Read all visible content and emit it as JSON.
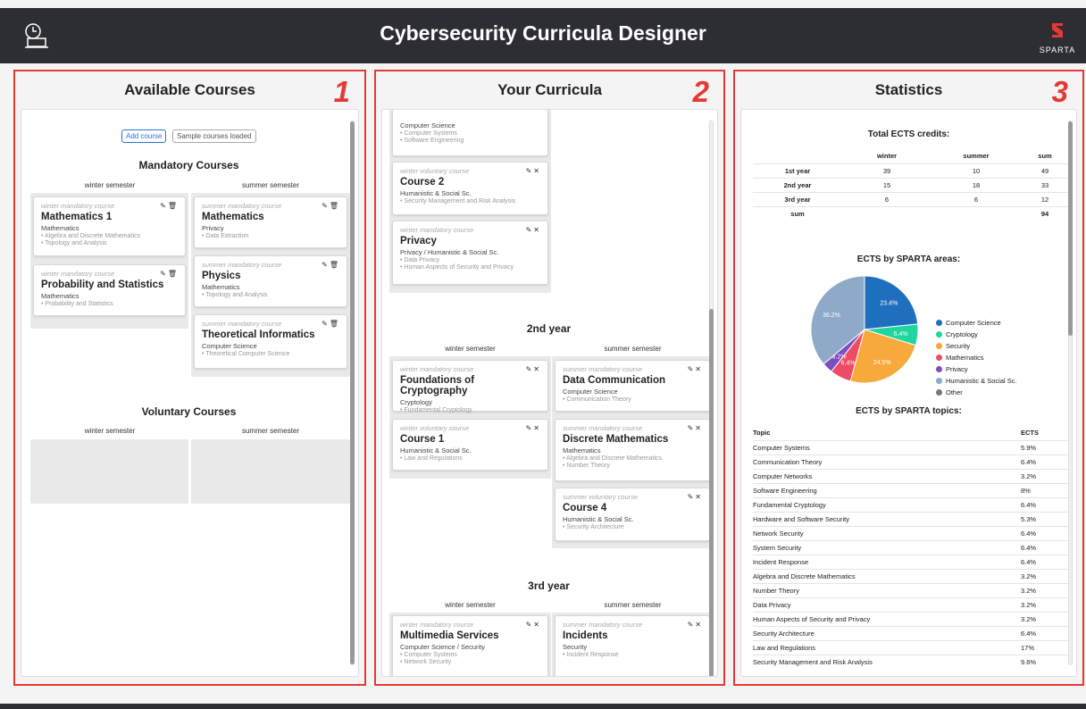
{
  "app": {
    "title": "Cybersecurity Curricula Designer",
    "logo_text": "SPARTA"
  },
  "colors": {
    "red": "#e53935",
    "dark": "#2d2e33"
  },
  "panels": {
    "available": "Available Courses",
    "curricula": "Your Curricula",
    "stats": "Statistics"
  },
  "numbers": [
    "1",
    "2",
    "3"
  ],
  "available": {
    "add_btn": "Add course",
    "sample_btn": "Sample courses loaded",
    "mandatory_title": "Mandatory Courses",
    "voluntary_title": "Voluntary Courses",
    "winter": "winter semester",
    "summer": "summer semester",
    "winter_cards": [
      {
        "type": "winter mandatory course",
        "name": "Mathematics 1",
        "area": "Mathematics",
        "topics": "• Algebra and Discrete Mathematics",
        "topics2": "• Topology and Analysis"
      },
      {
        "type": "winter mandatory course",
        "name": "Probability and Statistics",
        "area": "Mathematics",
        "topics": "• Probability and Statistics",
        "topics2": ""
      }
    ],
    "summer_cards": [
      {
        "type": "summer mandatory course",
        "name": "Mathematics",
        "area": "Privacy",
        "topics": "• Data Extraction",
        "topics2": ""
      },
      {
        "type": "summer mandatory course",
        "name": "Physics",
        "area": "Mathematics",
        "topics": "• Topology and Analysis",
        "topics2": ""
      },
      {
        "type": "summer mandatory course",
        "name": "Theoretical Informatics",
        "area": "Computer Science",
        "topics": "• Theoretical Computer Science",
        "topics2": ""
      }
    ]
  },
  "curricula": {
    "year2": "2nd year",
    "year3": "3rd year",
    "winter": "winter semester",
    "summer": "summer semester",
    "top_partial": {
      "area": "Computer Science",
      "t1": "• Computer Systems",
      "t2": "• Software Engineering"
    },
    "y1_cards": [
      {
        "type": "winter voluntary course",
        "name": "Course 2",
        "area": "Humanistic & Social Sc.",
        "topics": "• Security Management and Risk Analysis",
        "topics2": ""
      },
      {
        "type": "winter mandatory course",
        "name": "Privacy",
        "area": "Privacy / Humanistic & Social Sc.",
        "topics": "• Data Privacy",
        "topics2": "• Human Aspects of Security and Privacy"
      }
    ],
    "y2_winter": [
      {
        "type": "winter mandatory course",
        "name": "Foundations of Cryptography",
        "area": "Cryptology",
        "topics": "• Fundamental Cryptology",
        "topics2": ""
      },
      {
        "type": "winter voluntary course",
        "name": "Course 1",
        "area": "Humanistic & Social Sc.",
        "topics": "• Law and Regulations",
        "topics2": ""
      }
    ],
    "y2_summer": [
      {
        "type": "summer mandatory course",
        "name": "Data Communication",
        "area": "Computer Science",
        "topics": "• Communication Theory",
        "topics2": ""
      },
      {
        "type": "summer mandatory course",
        "name": "Discrete Mathematics",
        "area": "Mathematics",
        "topics": "• Algebra and Discrete Mathematics",
        "topics2": "• Number Theory"
      },
      {
        "type": "summer voluntary course",
        "name": "Course 4",
        "area": "Humanistic & Social Sc.",
        "topics": "• Security Architecture",
        "topics2": ""
      }
    ],
    "y3_winter": [
      {
        "type": "winter mandatory course",
        "name": "Multimedia Services",
        "area": "Computer Science / Security",
        "topics": "• Computer Systems",
        "topics2": "• Network Security"
      }
    ],
    "y3_summer": [
      {
        "type": "summer mandatory course",
        "name": "Incidents",
        "area": "Security",
        "topics": "• Incident Response",
        "topics2": ""
      }
    ]
  },
  "stats": {
    "ects_title": "Total ECTS credits:",
    "ects_headers": [
      "",
      "winter",
      "summer",
      "sum"
    ],
    "ects_rows": [
      [
        "1st year",
        "39",
        "10",
        "49"
      ],
      [
        "2nd year",
        "15",
        "18",
        "33"
      ],
      [
        "3rd year",
        "6",
        "6",
        "12"
      ],
      [
        "sum",
        "",
        "",
        "94"
      ]
    ],
    "areas_title": "ECTS by SPARTA areas:",
    "topics_title": "ECTS by SPARTA topics:",
    "topics_headers": [
      "Topic",
      "ECTS"
    ],
    "topics_rows": [
      [
        "Computer Systems",
        "5.9%"
      ],
      [
        "Communication Theory",
        "6.4%"
      ],
      [
        "Computer Networks",
        "3.2%"
      ],
      [
        "Software Engineering",
        "8%"
      ],
      [
        "Fundamental Cryptology",
        "6.4%"
      ],
      [
        "Hardware and Software Security",
        "5.3%"
      ],
      [
        "Network Security",
        "6.4%"
      ],
      [
        "System Security",
        "6.4%"
      ],
      [
        "Incident Response",
        "6.4%"
      ],
      [
        "Algebra and Discrete Mathematics",
        "3.2%"
      ],
      [
        "Number Theory",
        "3.2%"
      ],
      [
        "Data Privacy",
        "3.2%"
      ],
      [
        "Human Aspects of Security and Privacy",
        "3.2%"
      ],
      [
        "Security Architecture",
        "6.4%"
      ],
      [
        "Law and Regulations",
        "17%"
      ],
      [
        "Security Management and Risk Analysis",
        "9.6%"
      ]
    ]
  },
  "chart_data": {
    "type": "pie",
    "title": "ECTS by SPARTA areas:",
    "categories": [
      "Computer Science",
      "Cryptology",
      "Security",
      "Mathematics",
      "Privacy",
      "Humanistic & Social Sc.",
      "Other"
    ],
    "values": [
      23.4,
      6.4,
      24.5,
      6.4,
      3.2,
      36.2,
      0
    ],
    "labels": [
      "23.4%",
      "6.4%",
      "24.5%",
      "6.4%",
      "3.2%",
      "36.2%",
      ""
    ],
    "colors": [
      "#1f6fbf",
      "#1ed69e",
      "#f7a93b",
      "#ee4b65",
      "#7c4dbd",
      "#8fa9c8",
      "#777777"
    ],
    "legend": "right"
  }
}
